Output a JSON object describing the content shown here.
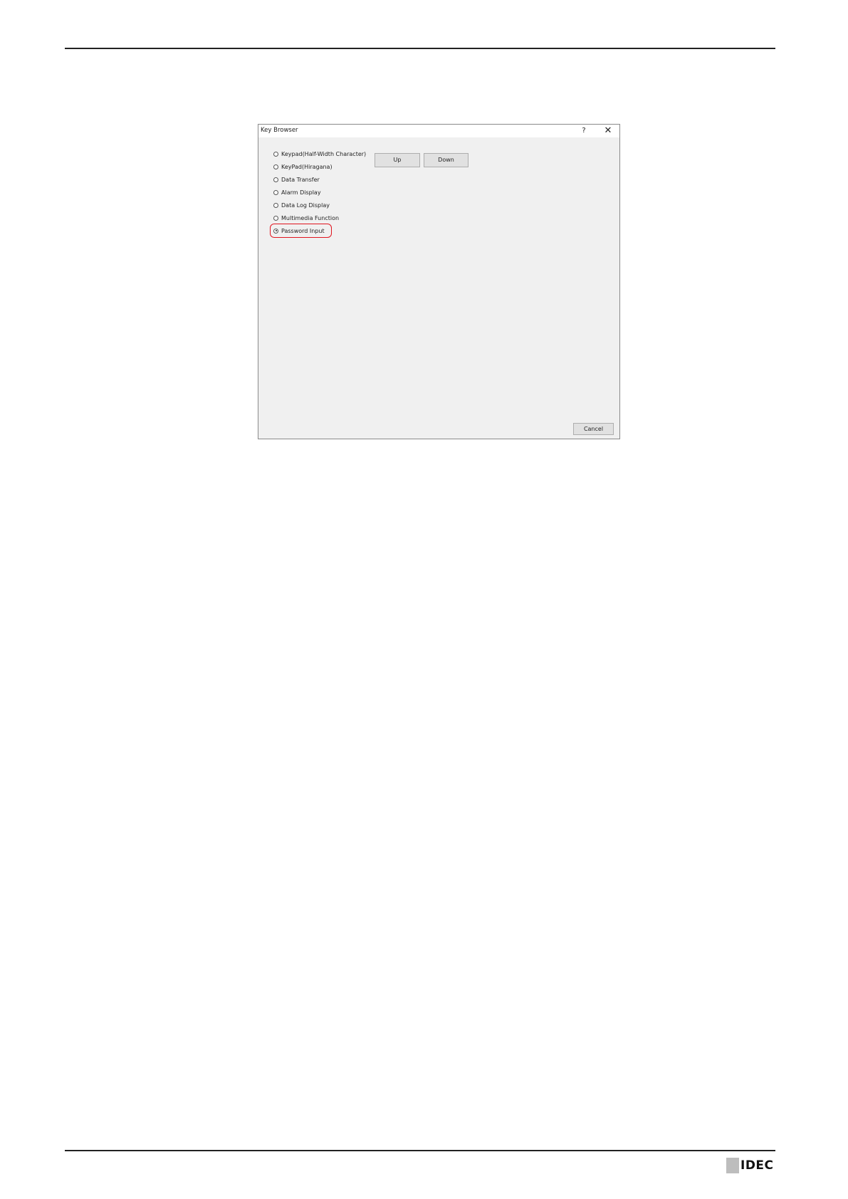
{
  "dialog": {
    "title": "Key Browser",
    "help_label": "?",
    "close_label": "✕",
    "radio_options": [
      {
        "label": "Keypad(Half-Width Character)",
        "checked": false
      },
      {
        "label": "KeyPad(Hiragana)",
        "checked": false
      },
      {
        "label": "Data Transfer",
        "checked": false
      },
      {
        "label": "Alarm Display",
        "checked": false
      },
      {
        "label": "Data Log Display",
        "checked": false
      },
      {
        "label": "Multimedia Function",
        "checked": false
      },
      {
        "label": "Password Input",
        "checked": true
      }
    ],
    "up_label": "Up",
    "down_label": "Down",
    "cancel_label": "Cancel",
    "highlight_color": "#e0141e"
  },
  "footer": {
    "logo_text": "IDEC"
  }
}
